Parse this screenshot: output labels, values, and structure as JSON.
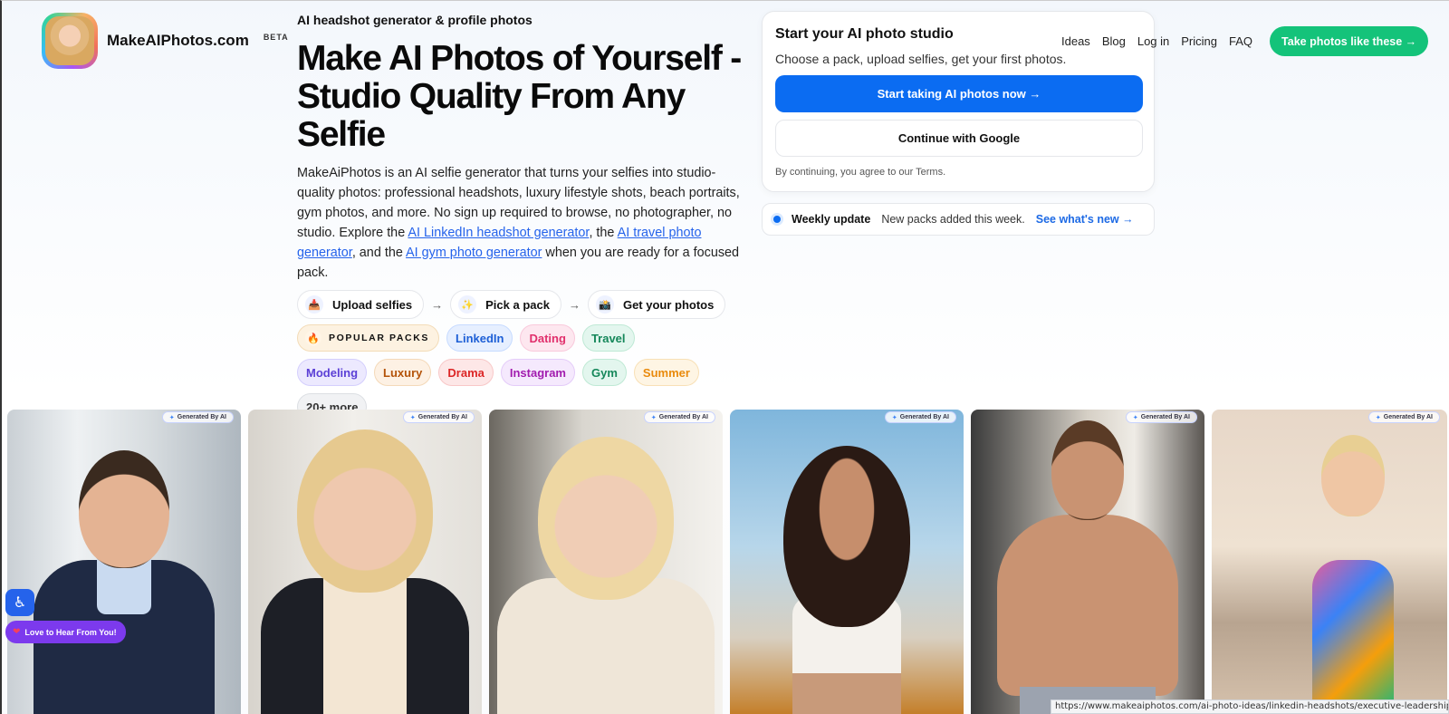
{
  "brand": {
    "name": "MakeAIPhotos.com",
    "badge": "BETA"
  },
  "hero": {
    "eyebrow": "AI headshot generator & profile photos",
    "headline": "Make AI Photos of Yourself - Studio Quality From Any Selfie",
    "desc_part1": "MakeAiPhotos is an AI selfie generator that turns your selfies into studio-quality photos: professional headshots, luxury lifestyle shots, beach portraits, gym photos, and more. No sign up required to browse, no photographer, no studio. Explore the ",
    "link1": "AI LinkedIn headshot generator",
    "desc_part2": ", the ",
    "link2": "AI travel photo generator",
    "desc_part3": ", and the ",
    "link3": "AI gym photo generator",
    "desc_part4": " when you are ready for a focused pack."
  },
  "steps": [
    {
      "label": "Upload selfies",
      "icon": "upload-icon",
      "glyph": "📥"
    },
    {
      "label": "Pick a pack",
      "icon": "sparkle-icon",
      "glyph": "✨"
    },
    {
      "label": "Get your photos",
      "icon": "camera-icon",
      "glyph": "📸"
    }
  ],
  "step_arrow": "→",
  "packs": {
    "popular_label": "POPULAR PACKS",
    "popular_icon": "fire-icon",
    "items": [
      {
        "label": "LinkedIn",
        "bg": "#e6efff",
        "border": "#c7dbff",
        "color": "#1d5fd6"
      },
      {
        "label": "Dating",
        "bg": "#fde7ef",
        "border": "#f9c9db",
        "color": "#e1306c"
      },
      {
        "label": "Travel",
        "bg": "#e3f6ee",
        "border": "#bfe9d5",
        "color": "#15875a"
      },
      {
        "label": "Modeling",
        "bg": "#ece9fe",
        "border": "#d4cffd",
        "color": "#5b3fd6"
      },
      {
        "label": "Luxury",
        "bg": "#fdf1e4",
        "border": "#f4d9b9",
        "color": "#b45309"
      },
      {
        "label": "Drama",
        "bg": "#fde7e7",
        "border": "#f8c8c8",
        "color": "#dc2626"
      },
      {
        "label": "Instagram",
        "bg": "#f5e9fd",
        "border": "#e4ccf9",
        "color": "#a21caf"
      },
      {
        "label": "Gym",
        "bg": "#e3f6ee",
        "border": "#bfe9d5",
        "color": "#15875a"
      },
      {
        "label": "Summer",
        "bg": "#fef5e4",
        "border": "#f8e0b6",
        "color": "#e98a0c"
      },
      {
        "label": "20+ more",
        "bg": "#f1f2f4",
        "border": "#dcdfe3",
        "color": "#333333"
      }
    ]
  },
  "start_card": {
    "title": "Start your AI photo studio",
    "subtitle": "Choose a pack, upload selfies, get your first photos.",
    "primary_button": "Start taking AI photos now →",
    "google_button": "Continue with Google",
    "terms": "By continuing, you agree to our Terms."
  },
  "nav": {
    "items": [
      "Ideas",
      "Blog",
      "Log in",
      "Pricing",
      "FAQ"
    ],
    "cta": "Take photos like these →"
  },
  "weekly": {
    "label": "Weekly update",
    "text": "New packs added this week.",
    "link": "See what's new →"
  },
  "gallery": {
    "badge_text": "Generated By AI",
    "badge_icon": "sparkle-icon",
    "photos": [
      {
        "alt": "professional man headshot"
      },
      {
        "alt": "blonde woman blazer"
      },
      {
        "alt": "blonde woman sweater"
      },
      {
        "alt": "woman helicopter"
      },
      {
        "alt": "shirtless man gym"
      },
      {
        "alt": "woman beach swimsuit"
      }
    ]
  },
  "widgets": {
    "accessibility_icon": "accessibility-icon",
    "feedback_label": "Love to Hear From You!"
  },
  "status_url": "https://www.makeaiphotos.com/ai-photo-ideas/linkedin-headshots/executive-leadership-vib"
}
